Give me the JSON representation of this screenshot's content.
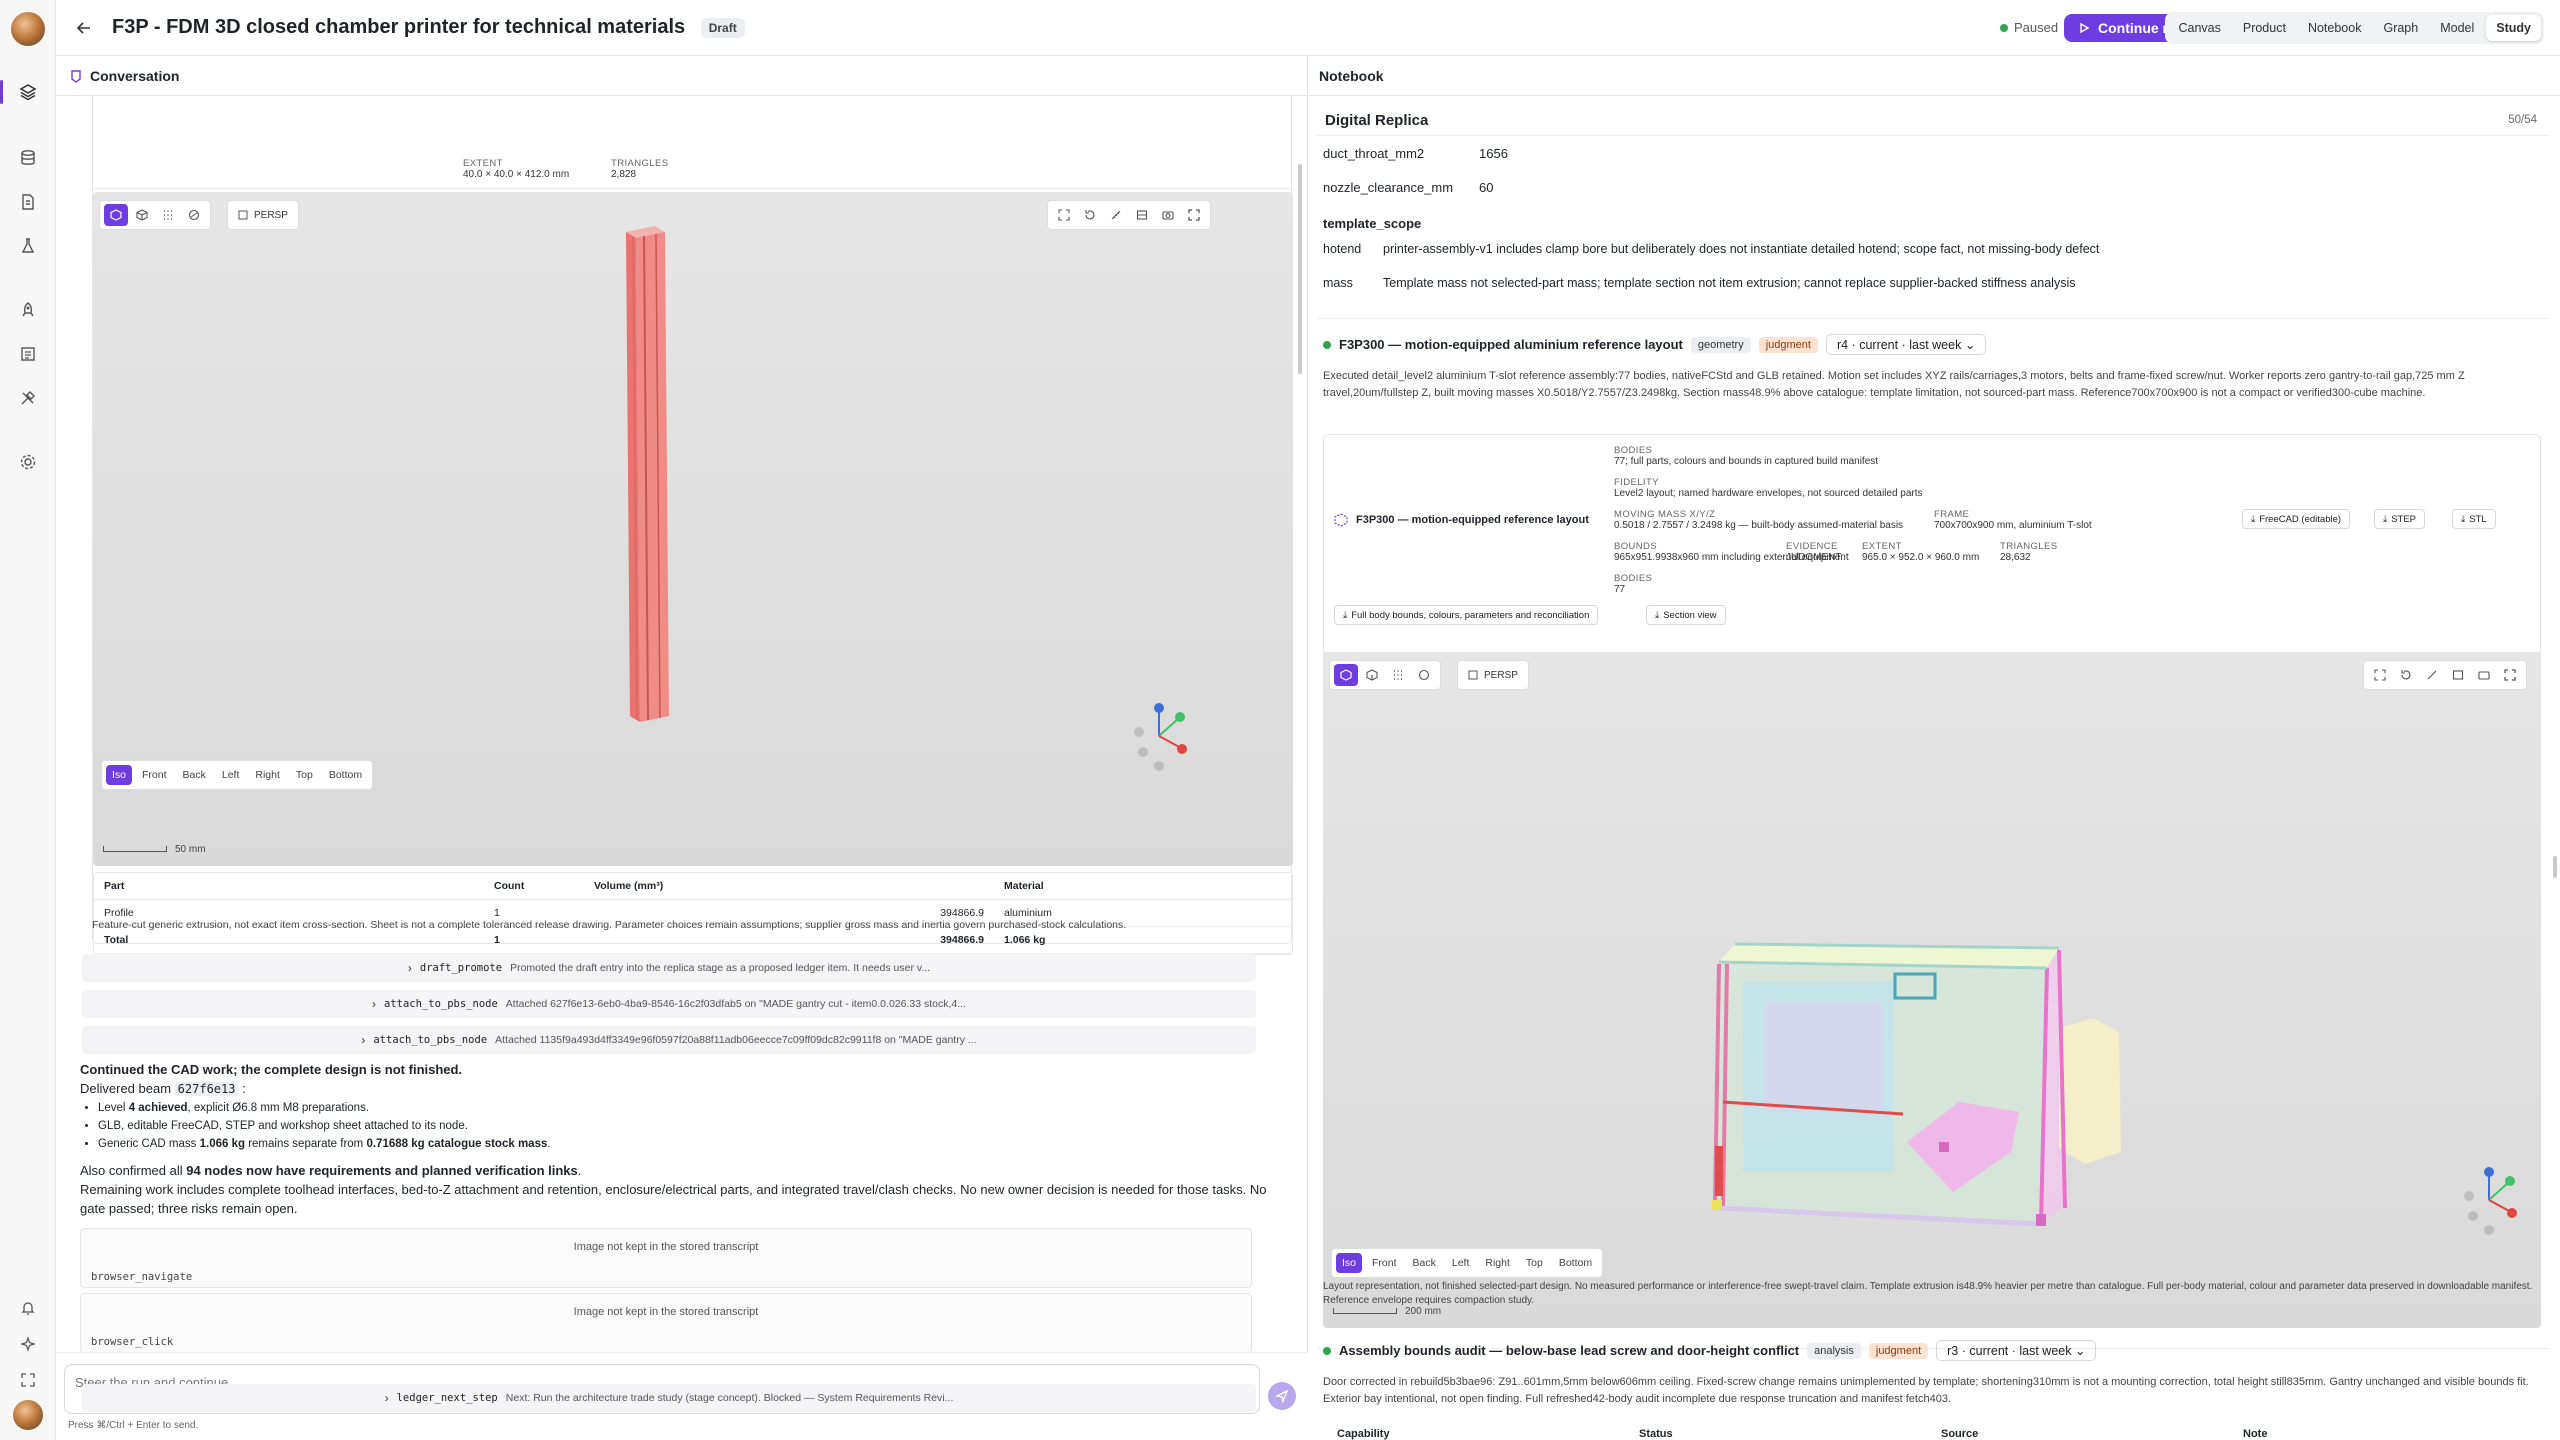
{
  "header": {
    "title": "F3P - FDM 3D closed chamber printer for technical materials",
    "badge": "Draft",
    "status": "Paused",
    "continue_label": "Continue run",
    "tabs": [
      "Canvas",
      "Product",
      "Notebook",
      "Graph",
      "Model",
      "Study"
    ],
    "active_tab": "Study"
  },
  "colors": {
    "accent": "#6d3de0",
    "status_green": "#2ea44f",
    "judgment_tag": "#fde2cf"
  },
  "left": {
    "title": "Conversation",
    "top_meta": [
      {
        "label": "EXTENT",
        "value": "40.0 × 40.0 × 412.0 mm"
      },
      {
        "label": "TRIANGLES",
        "value": "2,828"
      }
    ],
    "viewer": {
      "persp": "PERSP",
      "views": [
        "Iso",
        "Front",
        "Back",
        "Left",
        "Right",
        "Top",
        "Bottom"
      ],
      "scale": "50 mm"
    },
    "parts_table": {
      "headers": [
        "Part",
        "Count",
        "Volume (mm³)",
        "Material"
      ],
      "rows": [
        [
          "Profile",
          "1",
          "394866.9",
          "aluminium"
        ],
        [
          "Total",
          "1",
          "394866.9",
          "1.066 kg"
        ]
      ]
    },
    "note": "Feature-cut generic extrusion, not exact item cross-section. Sheet is not a complete toleranced release drawing. Parameter choices remain assumptions; supplier gross mass and inertia govern purchased-stock calculations.",
    "tool_calls": [
      {
        "name": "draft_promote",
        "desc": "Promoted the draft entry into the replica stage as a proposed ledger item. It needs user v..."
      },
      {
        "name": "attach_to_pbs_node",
        "desc": "Attached 627f6e13-6eb0-4ba9-8546-16c2f03dfab5 on \"MADE gantry cut - item0.0.026.33 stock,4..."
      },
      {
        "name": "attach_to_pbs_node",
        "desc": "Attached 1135f9a493d4ff3349e96f0597f20a88f11adb06eecce7c09ff09dc82c9911f8 on \"MADE gantry ..."
      }
    ],
    "message": {
      "heading": "Continued the CAD work; the complete design is not finished.",
      "delivered_prefix": "Delivered beam",
      "beam_id": "627f6e13",
      "delivered_suffix": ":",
      "bullets": [
        {
          "a": "Level ",
          "b": "4 achieved",
          "c": ", explicit Ø6.8 mm M8 preparations."
        },
        {
          "a": "GLB, editable FreeCAD, STEP and workshop sheet attached to its node.",
          "b": "",
          "c": ""
        },
        {
          "a": "Generic CAD mass ",
          "b": "1.066 kg",
          "c": " remains separate from ",
          "d": "0.71688 kg catalogue stock mass",
          "e": "."
        }
      ],
      "also_prefix": "Also confirmed all ",
      "also_bold": "94 nodes now have requirements and planned verification links",
      "also_suffix": ".",
      "remaining": "Remaining work includes complete toolhead interfaces, bed-to-Z attachment and retention, enclosure/electrical parts, and integrated travel/clash checks. No new owner decision is needed for those tasks. No gate passed; three risks remain open."
    },
    "images": [
      {
        "caption": "Image not kept in the stored transcript",
        "tool": "browser_navigate"
      },
      {
        "caption": "Image not kept in the stored transcript",
        "tool": "browser_click"
      }
    ],
    "ledger": {
      "name": "ledger_next_step",
      "desc": "Next: Run the architecture trade study (stage concept). Blocked — System Requirements Revi..."
    },
    "composer": {
      "placeholder": "Steer the run and continue...",
      "hint": "Press ⌘/Ctrl + Enter to send."
    }
  },
  "right": {
    "title": "Notebook",
    "section_title": "Digital Replica",
    "counter": "50/54",
    "kv": [
      {
        "k": "duct_throat_mm2",
        "v": "1656"
      },
      {
        "k": "nozzle_clearance_mm",
        "v": "60"
      }
    ],
    "template_scope": {
      "title": "template_scope",
      "rows": [
        {
          "k": "hotend",
          "v": "printer-assembly-v1 includes clamp bore but deliberately does not instantiate detailed hotend; scope fact, not missing-body defect"
        },
        {
          "k": "mass",
          "v": "Template mass not selected-part mass; template section not item extrusion; cannot replace supplier-backed stiffness analysis"
        }
      ]
    },
    "entry1": {
      "title": "F3P300 — motion-equipped aluminium reference layout",
      "tags": [
        "geometry",
        "judgment"
      ],
      "revision": "r4 · current · last week",
      "desc": "Executed detail_level2 aluminium T-slot reference assembly:77 bodies, nativeFCStd and GLB retained. Motion set includes XYZ rails/carriages,3 motors, belts and frame-fixed screw/nut. Worker reports zero gantry-to-rail gap,725 mm Z travel,20um/fullstep Z, built moving masses X0.5018/Y2.7557/Z3.2498kg. Section mass48.9% above catalogue: template limitation, not sourced-part mass. Reference700x700x900 is not a compact or verified300-cube machine.",
      "model_name": "F3P300 — motion-equipped reference layout",
      "meta": [
        {
          "label": "BODIES",
          "value": "77; full parts, colours and bounds in captured build manifest"
        },
        {
          "label": "FIDELITY",
          "value": "Level2 layout; named hardware envelopes, not sourced detailed parts"
        },
        {
          "label": "MOVING MASS X/Y/Z",
          "value": "0.5018 / 2.7557 / 3.2498 kg — built-body assumed-material basis"
        },
        {
          "label": "FRAME",
          "value": "700x700x900 mm, aluminium T-slot"
        },
        {
          "label": "BOUNDS",
          "value": "965x951.9938x960 mm including external equipment"
        },
        {
          "label": "EVIDENCE",
          "value": "JUDGMENT"
        },
        {
          "label": "EXTENT",
          "value": "965.0 × 952.0 × 960.0 mm"
        },
        {
          "label": "TRIANGLES",
          "value": "28,632"
        },
        {
          "label": "BODIES",
          "value": "77"
        }
      ],
      "downloads": [
        "FreeCAD (editable)",
        "STEP",
        "STL"
      ],
      "actions": [
        "Full body bounds, colours, parameters and reconciliation",
        "Section view"
      ],
      "viewer": {
        "persp": "PERSP",
        "views": [
          "Iso",
          "Front",
          "Back",
          "Left",
          "Right",
          "Top",
          "Bottom"
        ],
        "scale": "200 mm"
      },
      "caption": "Layout representation, not finished selected-part design. No measured performance or interference-free swept-travel claim. Template extrusion is48.9% heavier per metre than catalogue. Full per-body material, colour and parameter data preserved in downloadable manifest. Reference envelope requires compaction study."
    },
    "entry2": {
      "title": "Assembly bounds audit — below-base lead screw and door-height conflict",
      "tags": [
        "analysis",
        "judgment"
      ],
      "revision": "r3 · current · last week",
      "desc": "Door corrected in rebuild5b3bae96: Z91..601mm,5mm below606mm ceiling. Fixed-screw change remains unimplemented by template; shortening310mm is not a mounting correction, total height still835mm. Gantry unchanged and visible bounds fit. Exterior bay intentional, not open finding. Full refreshed42-body audit incomplete due response truncation and manifest fetch403.",
      "table_headers": [
        "Capability",
        "Status",
        "Source",
        "Note"
      ]
    }
  }
}
